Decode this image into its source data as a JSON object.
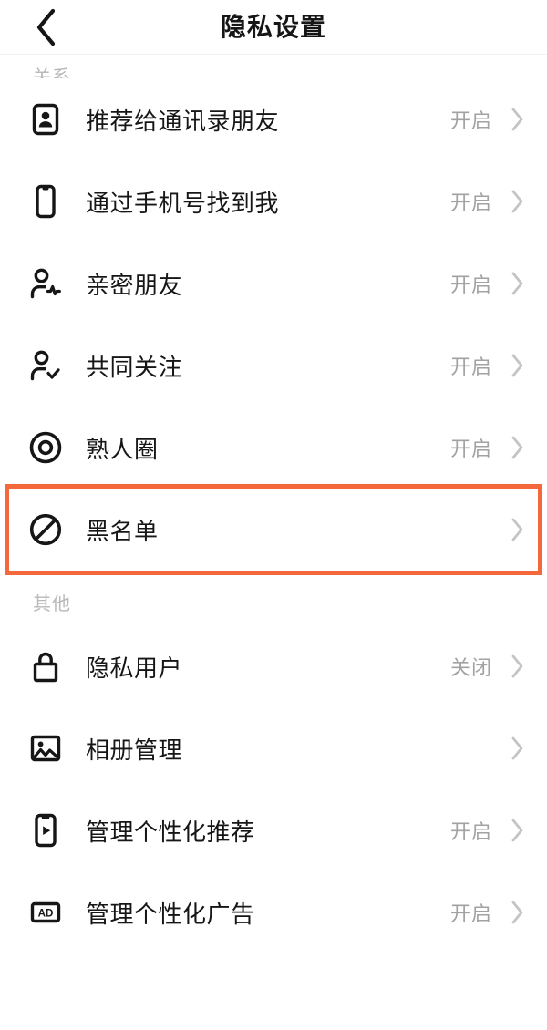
{
  "header": {
    "title": "隐私设置",
    "back_icon": "chevron-left-icon"
  },
  "sections": [
    {
      "label": "关系",
      "clipped": true,
      "items": [
        {
          "icon": "contact-card-icon",
          "label": "推荐给通讯录朋友",
          "status": "开启",
          "chevron": "chevron-right-icon",
          "highlighted": false
        },
        {
          "icon": "phone-icon",
          "label": "通过手机号找到我",
          "status": "开启",
          "chevron": "chevron-right-icon",
          "highlighted": false
        },
        {
          "icon": "person-pulse-icon",
          "label": "亲密朋友",
          "status": "开启",
          "chevron": "chevron-right-icon",
          "highlighted": false
        },
        {
          "icon": "person-check-icon",
          "label": "共同关注",
          "status": "开启",
          "chevron": "chevron-right-icon",
          "highlighted": false
        },
        {
          "icon": "target-circle-icon",
          "label": "熟人圈",
          "status": "开启",
          "chevron": "chevron-right-icon",
          "highlighted": false
        },
        {
          "icon": "prohibition-icon",
          "label": "黑名单",
          "status": "",
          "chevron": "chevron-right-icon",
          "highlighted": true
        }
      ]
    },
    {
      "label": "其他",
      "clipped": false,
      "items": [
        {
          "icon": "lock-icon",
          "label": "隐私用户",
          "status": "关闭",
          "chevron": "chevron-right-icon",
          "highlighted": false
        },
        {
          "icon": "photo-icon",
          "label": "相册管理",
          "status": "",
          "chevron": "chevron-right-icon",
          "highlighted": false
        },
        {
          "icon": "phone-play-icon",
          "label": "管理个性化推荐",
          "status": "开启",
          "chevron": "chevron-right-icon",
          "highlighted": false
        },
        {
          "icon": "ad-badge-icon",
          "label": "管理个性化广告",
          "status": "开启",
          "chevron": "chevron-right-icon",
          "highlighted": false
        }
      ]
    }
  ],
  "colors": {
    "highlight": "#f4683c",
    "text": "#161616",
    "muted": "#a2a2a2",
    "section_label": "#b9b9b9",
    "background": "#ffffff"
  }
}
